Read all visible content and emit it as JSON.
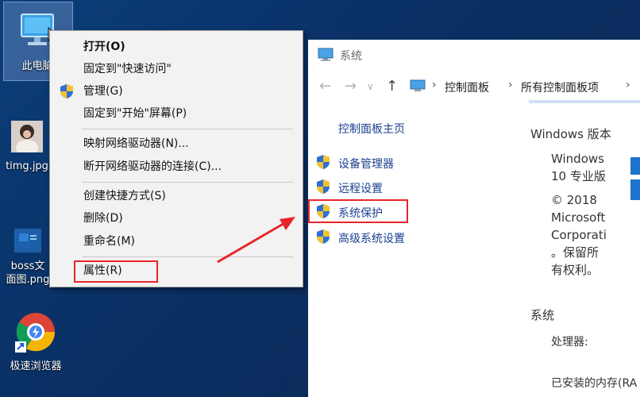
{
  "desktop": {
    "icons": [
      {
        "label": "此电脑"
      },
      {
        "label": "timg.jpg"
      },
      {
        "label_line1": "boss文",
        "label_line2": "面图.png"
      },
      {
        "label": "极速浏览器"
      }
    ]
  },
  "context_menu": {
    "items": [
      {
        "label": "打开(O)"
      },
      {
        "label": "固定到\"快速访问\""
      },
      {
        "label": "管理(G)"
      },
      {
        "label": "固定到\"开始\"屏幕(P)"
      },
      {
        "label": "映射网络驱动器(N)..."
      },
      {
        "label": "断开网络驱动器的连接(C)..."
      },
      {
        "label": "创建快捷方式(S)"
      },
      {
        "label": "删除(D)"
      },
      {
        "label": "重命名(M)"
      },
      {
        "label": "属性(R)"
      }
    ]
  },
  "system_window": {
    "title": "系统",
    "breadcrumb": [
      "控制面板",
      "所有控制面板项"
    ],
    "left_links": [
      "控制面板主页",
      "设备管理器",
      "远程设置",
      "系统保护",
      "高级系统设置"
    ],
    "windows_edition_heading": "Windows 版本",
    "windows_edition_lines": [
      "Windows",
      "10 专业版",
      "© 2018",
      "Microsoft",
      "Corporati",
      "。保留所",
      "有权利。"
    ],
    "system_heading": "系统",
    "processor_label": "处理器:",
    "ram_label": "已安装的内存(RA"
  },
  "colors": {
    "highlight": "#e8252a",
    "link": "#1a3f8f",
    "desktop": "#0b3e7a"
  }
}
